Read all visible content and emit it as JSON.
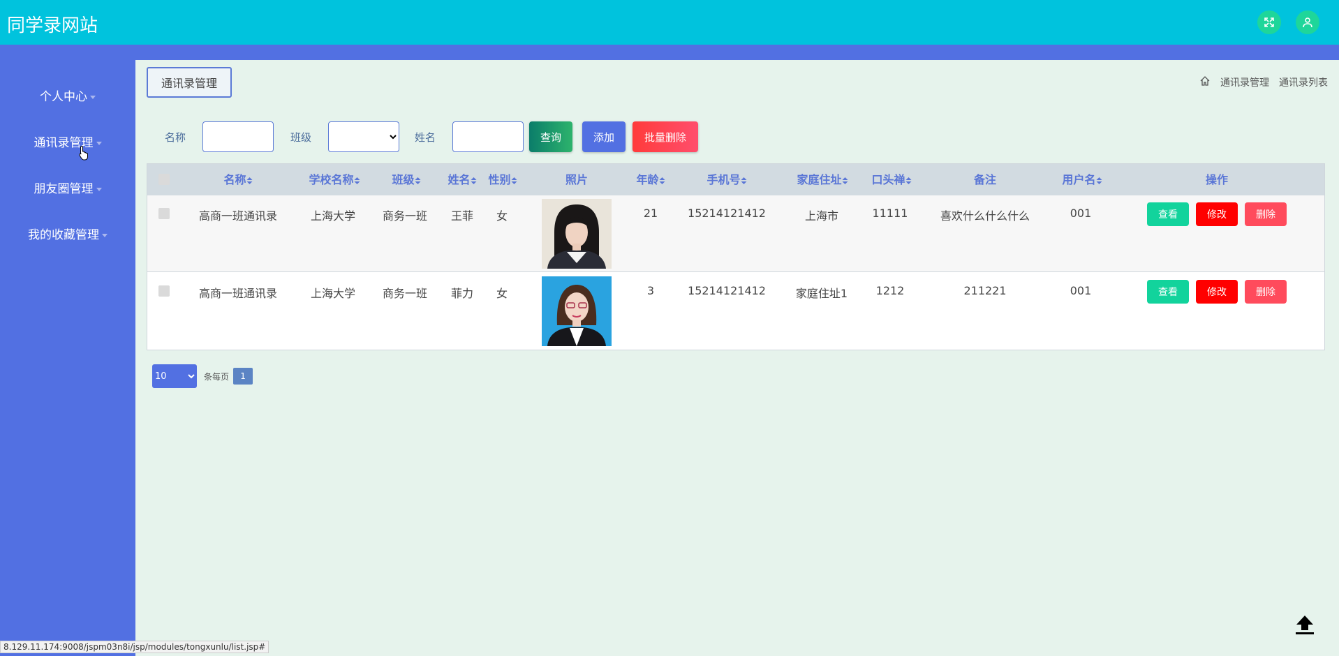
{
  "app": {
    "title": "同学录网站"
  },
  "icons": {
    "fullscreen": "fullscreen-icon",
    "user": "user-icon",
    "home": "home-icon",
    "top": "arrow-up-to-line-icon"
  },
  "colors": {
    "header": "#00c3dd",
    "sidebar": "#5270e2",
    "accent": "#1ed69a",
    "danger": "#ff0000"
  },
  "sidebar": {
    "items": [
      {
        "label": "个人中心"
      },
      {
        "label": "通讯录管理"
      },
      {
        "label": "朋友圈管理"
      },
      {
        "label": "我的收藏管理"
      }
    ]
  },
  "main": {
    "tab": "通讯录管理",
    "breadcrumb": [
      "通讯录管理",
      "通讯录列表"
    ]
  },
  "search": {
    "name_label": "名称",
    "name_value": "",
    "class_label": "班级",
    "class_value": "",
    "person_label": "姓名",
    "person_value": "",
    "query": "查询",
    "add": "添加",
    "batch_delete": "批量删除"
  },
  "table": {
    "headers": [
      "名称",
      "学校名称",
      "班级",
      "姓名",
      "性别",
      "照片",
      "年龄",
      "手机号",
      "家庭住址",
      "口头禅",
      "备注",
      "用户名",
      "操作"
    ],
    "rows": [
      {
        "name": "高商一班通讯录",
        "school": "上海大学",
        "class": "商务一班",
        "person": "王菲",
        "gender": "女",
        "age": "21",
        "phone": "15214121412",
        "address": "上海市",
        "catchphrase": "11111",
        "remark": "喜欢什么什么什么",
        "username": "001"
      },
      {
        "name": "高商一班通讯录",
        "school": "上海大学",
        "class": "商务一班",
        "person": "菲力",
        "gender": "女",
        "age": "3",
        "phone": "15214121412",
        "address": "家庭住址1",
        "catchphrase": "1212",
        "remark": "211221",
        "username": "001"
      }
    ],
    "actions": {
      "view": "查看",
      "edit": "修改",
      "delete": "删除"
    }
  },
  "pager": {
    "size": "10",
    "per_page": "条每页",
    "page": "1"
  },
  "status_url": "8.129.11.174:9008/jspm03n8i/jsp/modules/tongxunlu/list.jsp#"
}
